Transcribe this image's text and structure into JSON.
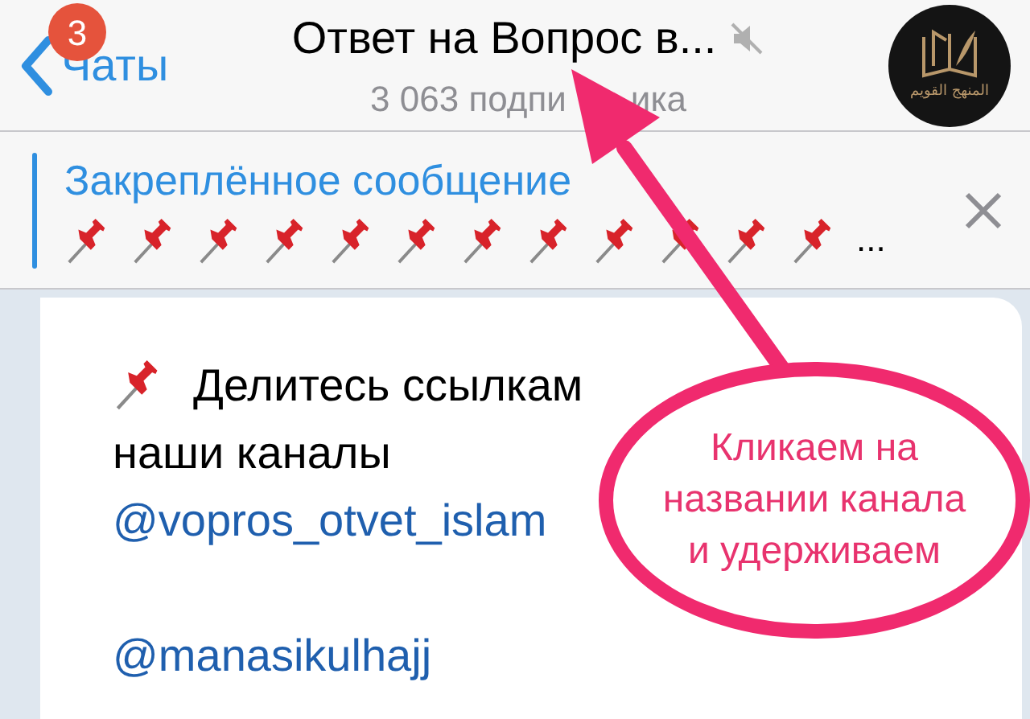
{
  "header": {
    "back_label": "Чаты",
    "unread_badge": "3",
    "title": "Ответ на Вопрос в...",
    "muted": true,
    "subtitle_parts": [
      "3 063 подпи",
      "ика"
    ],
    "avatar_caption": "المنهج القويم"
  },
  "pinned": {
    "title": "Закреплённое сообщение",
    "preview_ellipsis": "..."
  },
  "message": {
    "first_line": "Делитесь ссылкам",
    "second_line": "наши каналы",
    "links": [
      "@vopros_otvet_islam",
      "@manasikulhajj"
    ]
  },
  "annotation": {
    "text_lines": [
      "Кликаем на",
      "названии канала",
      "и удерживаем"
    ]
  }
}
